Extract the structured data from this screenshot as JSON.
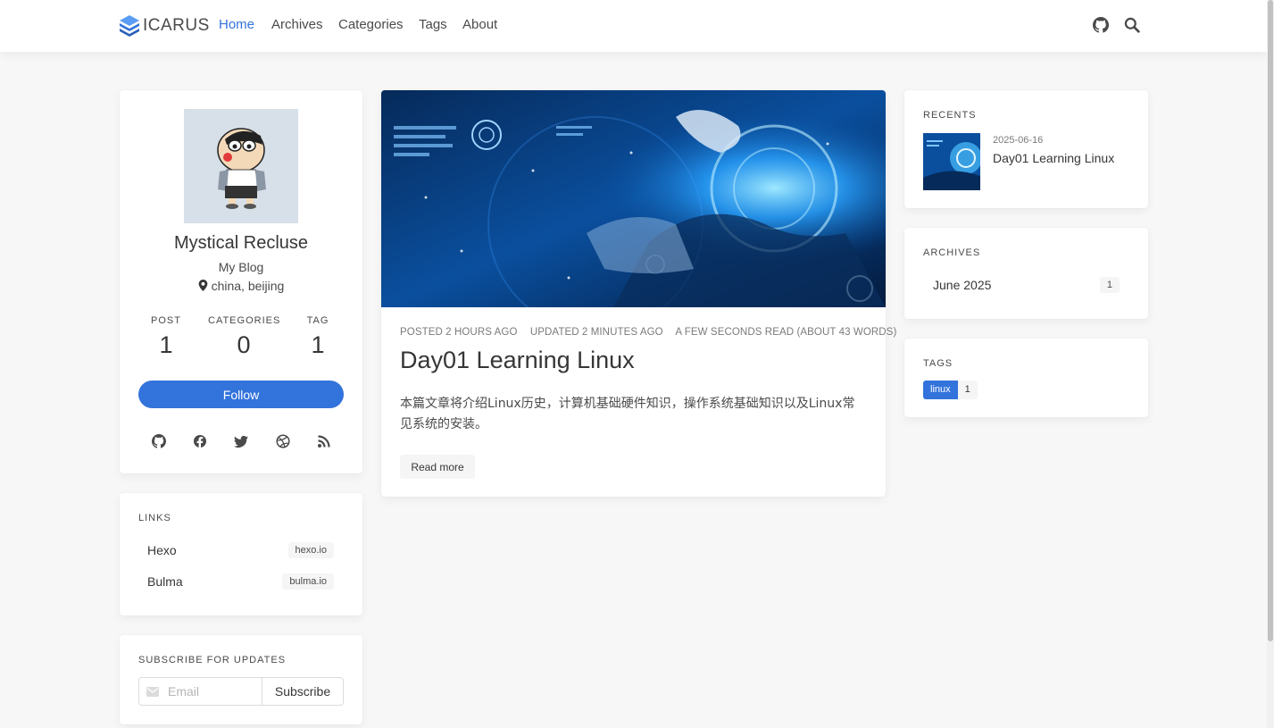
{
  "brand": {
    "name": "ICARUS"
  },
  "nav": {
    "items": [
      "Home",
      "Archives",
      "Categories",
      "Tags",
      "About"
    ],
    "active": "Home"
  },
  "colors": {
    "accent": "#3273dc",
    "background": "#f7f7f7"
  },
  "profile": {
    "name": "Mystical Recluse",
    "subtitle": "My Blog",
    "location": "china, beijing",
    "stats": [
      {
        "label": "POST",
        "value": "1"
      },
      {
        "label": "CATEGORIES",
        "value": "0"
      },
      {
        "label": "TAG",
        "value": "1"
      }
    ],
    "follow_label": "Follow",
    "social_icons": [
      "github-icon",
      "facebook-icon",
      "twitter-icon",
      "dribbble-icon",
      "rss-icon"
    ]
  },
  "links": {
    "title": "LINKS",
    "items": [
      {
        "name": "Hexo",
        "host": "hexo.io"
      },
      {
        "name": "Bulma",
        "host": "bulma.io"
      }
    ]
  },
  "subscribe": {
    "title": "SUBSCRIBE FOR UPDATES",
    "placeholder": "Email",
    "button": "Subscribe"
  },
  "article": {
    "meta": [
      "POSTED 2 HOURS AGO",
      "UPDATED 2 MINUTES AGO",
      "A FEW SECONDS READ (ABOUT 43 WORDS)"
    ],
    "title": "Day01 Learning Linux",
    "excerpt": "本篇文章将介绍Linux历史，计算机基础硬件知识，操作系统基础知识以及Linux常见系统的安装。",
    "read_more": "Read more"
  },
  "recents": {
    "title": "RECENTS",
    "items": [
      {
        "date": "2025-06-16",
        "title": "Day01 Learning Linux"
      }
    ]
  },
  "archives": {
    "title": "ARCHIVES",
    "items": [
      {
        "label": "June 2025",
        "count": "1"
      }
    ]
  },
  "tags": {
    "title": "TAGS",
    "items": [
      {
        "name": "linux",
        "count": "1"
      }
    ]
  }
}
